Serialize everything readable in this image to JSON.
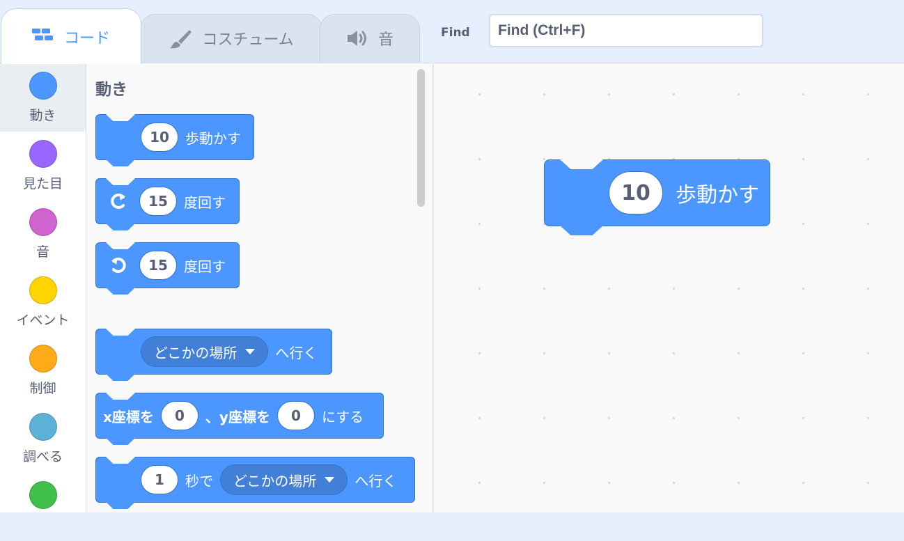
{
  "tabs": [
    {
      "label": "コード",
      "icon": "code-blocks-icon",
      "active": true
    },
    {
      "label": "コスチューム",
      "icon": "paintbrush-icon",
      "active": false
    },
    {
      "label": "音",
      "icon": "speaker-icon",
      "active": false
    }
  ],
  "find": {
    "label": "Find",
    "placeholder": "Find (Ctrl+F)"
  },
  "categories": [
    {
      "label": "動き",
      "color": "#4c97ff",
      "selected": true
    },
    {
      "label": "見た目",
      "color": "#9966ff",
      "selected": false
    },
    {
      "label": "音",
      "color": "#cf63cf",
      "selected": false
    },
    {
      "label": "イベント",
      "color": "#ffd500",
      "selected": false
    },
    {
      "label": "制御",
      "color": "#ffab19",
      "selected": false
    },
    {
      "label": "調べる",
      "color": "#5cb1d6",
      "selected": false
    },
    {
      "label": "",
      "color": "#40bf4a",
      "selected": false
    }
  ],
  "palette": {
    "title": "動き",
    "blocks": [
      {
        "name": "move-steps",
        "value": "10",
        "text": "歩動かす"
      },
      {
        "name": "turn-right",
        "icon": "rotate-clockwise-icon",
        "value": "15",
        "text": "度回す"
      },
      {
        "name": "turn-left",
        "icon": "rotate-counterclockwise-icon",
        "value": "15",
        "text": "度回す"
      },
      {
        "name": "goto",
        "dropdown": "どこかの場所",
        "text": "へ行く"
      },
      {
        "name": "goto-xy",
        "prefix": "x座標を",
        "x": "0",
        "mid": "、y座標を",
        "y": "0",
        "suffix": "にする"
      },
      {
        "name": "glide",
        "value": "1",
        "text1": "秒で",
        "dropdown": "どこかの場所",
        "text2": "へ行く"
      }
    ]
  },
  "workspace": {
    "block": {
      "value": "10",
      "text": "歩動かす"
    }
  },
  "colors": {
    "motion": "#4c97ff",
    "motion_dark": "#3373cc",
    "accent": "#4c97ff",
    "text": "#575e75",
    "topbar": "#e5effd"
  }
}
